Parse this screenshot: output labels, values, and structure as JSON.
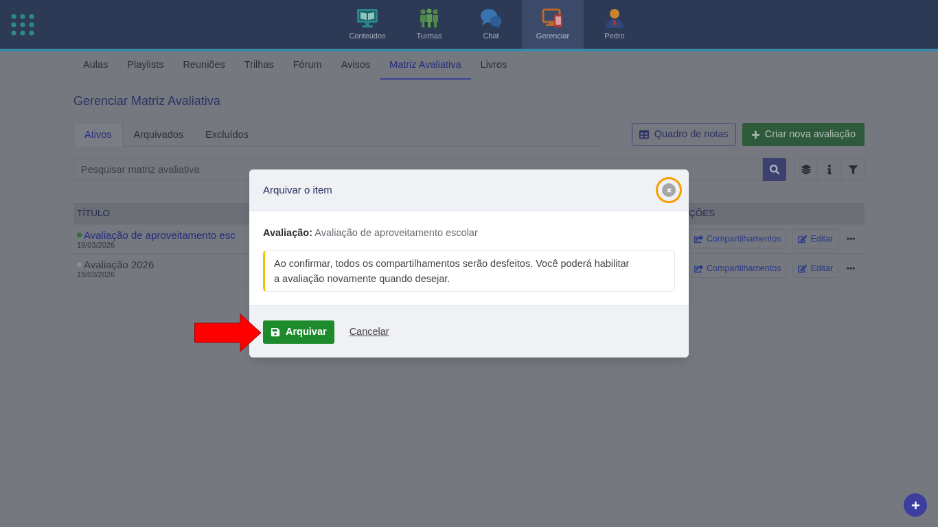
{
  "top_nav": {
    "items": [
      {
        "label": "Conteúdos",
        "kind": "monitor",
        "selected": false
      },
      {
        "label": "Turmas",
        "kind": "people",
        "selected": false
      },
      {
        "label": "Chat",
        "kind": "chat",
        "selected": false
      },
      {
        "label": "Gerenciar",
        "kind": "devices",
        "selected": true
      },
      {
        "label": "Pedro",
        "kind": "avatar",
        "selected": false
      }
    ]
  },
  "sub_nav": {
    "items": [
      {
        "label": "Aulas",
        "selected": false
      },
      {
        "label": "Playlists",
        "selected": false
      },
      {
        "label": "Reuniões",
        "selected": false
      },
      {
        "label": "Trilhas",
        "selected": false
      },
      {
        "label": "Fórum",
        "selected": false
      },
      {
        "label": "Avisos",
        "selected": false
      },
      {
        "label": "Matriz Avaliativa",
        "selected": true
      },
      {
        "label": "Livros",
        "selected": false
      }
    ]
  },
  "page_title": "Gerenciar Matriz Avaliativa",
  "tabs": [
    {
      "label": "Ativos",
      "selected": true
    },
    {
      "label": "Arquivados",
      "selected": false
    },
    {
      "label": "Excluídos",
      "selected": false
    }
  ],
  "toolbar": {
    "buttons": [
      {
        "label": "Quadro de notas",
        "kind": "outline"
      },
      {
        "label": "Criar nova avaliação",
        "kind": "primary"
      }
    ]
  },
  "search": {
    "placeholder": "Pesquisar matriz avaliativa"
  },
  "table": {
    "columns": [
      "TÍTULO",
      "ÇÕES"
    ],
    "rows": [
      {
        "title": "Avaliação de aproveitamento esc",
        "date": "19/03/2026",
        "active": true,
        "color": "#2f6e3c",
        "actions": [
          {
            "label": "Compartilhamentos",
            "kind": "share"
          },
          {
            "label": "Editar",
            "kind": "edit"
          }
        ]
      },
      {
        "title": "Avaliação 2026",
        "date": "19/03/2026",
        "active": false,
        "color": "#8c8e94",
        "actions": [
          {
            "label": "Compartilhamentos",
            "kind": "share"
          },
          {
            "label": "Editar",
            "kind": "edit"
          }
        ]
      }
    ]
  },
  "modal": {
    "title": "Arquivar o item",
    "close_highlighted": true,
    "field": "**Avaliação:** Avaliação de aproveitamento escolar",
    "notice": "Ao confirmar, todos os compartilhamentos serão desfeitos. Você poderá habilitar a avaliação novamente quando desejar.",
    "confirm": "Arquivar",
    "confirm_pointed": true,
    "cancel": "Cancelar"
  }
}
